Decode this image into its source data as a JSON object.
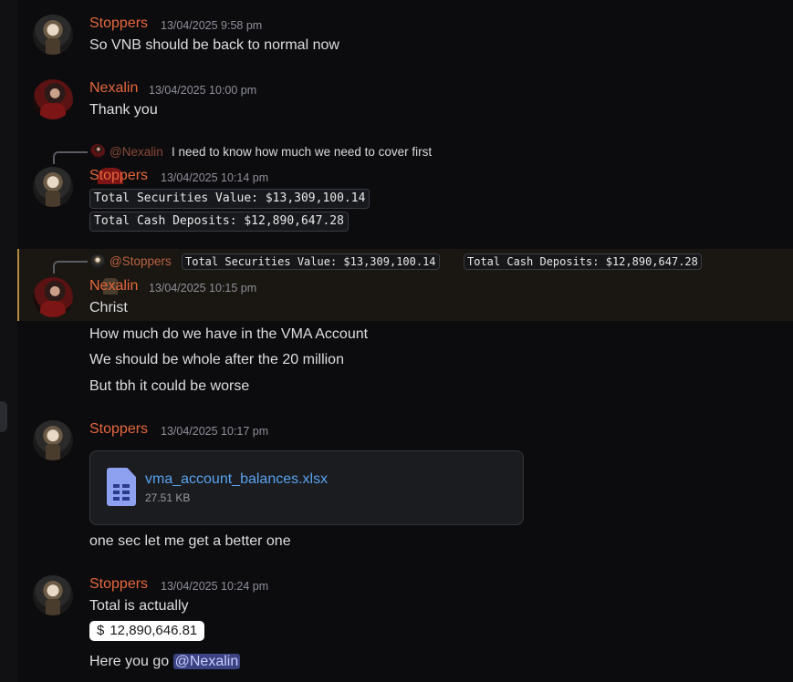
{
  "messages": [
    {
      "author": "Stoppers",
      "timestamp": "13/04/2025 9:58 pm",
      "lines": [
        "So VNB should be back to normal now"
      ]
    },
    {
      "author": "Nexalin",
      "timestamp": "13/04/2025 10:00 pm",
      "lines": [
        "Thank you"
      ]
    },
    {
      "reply": {
        "author": "@Nexalin",
        "text": "I need to know how much we need to cover first"
      },
      "author": "Stoppers",
      "timestamp": "13/04/2025 10:14 pm",
      "codes": [
        "Total Securities Value: $13,309,100.14",
        "Total Cash Deposits: $12,890,647.28"
      ]
    },
    {
      "reply": {
        "author": "@Stoppers",
        "codes": [
          "Total Securities Value: $13,309,100.14",
          "Total Cash Deposits: $12,890,647.28"
        ]
      },
      "author": "Nexalin",
      "timestamp": "13/04/2025 10:15 pm",
      "lines": [
        "Christ",
        "How much do we have in the VMA Account",
        "We should be whole after the 20 million",
        "But tbh it could be worse"
      ]
    },
    {
      "author": "Stoppers",
      "timestamp": "13/04/2025 10:17 pm",
      "attachment": {
        "filename": "vma_account_balances.xlsx",
        "size": "27.51 KB",
        "icon": "spreadsheet-icon"
      },
      "lines": [
        "one sec let me get a better one"
      ]
    },
    {
      "author": "Stoppers",
      "timestamp": "13/04/2025 10:24 pm",
      "lines": [
        "Total is actually"
      ],
      "amount": {
        "currency": "$",
        "value": "12,890,646.81"
      },
      "final": {
        "text": "Here you go",
        "mention": "@Nexalin"
      }
    }
  ],
  "colors": {
    "author": "#e5673c",
    "highlight_border": "#b08a40",
    "link": "#5aa2ee",
    "mention_bg": "#3c4383"
  }
}
